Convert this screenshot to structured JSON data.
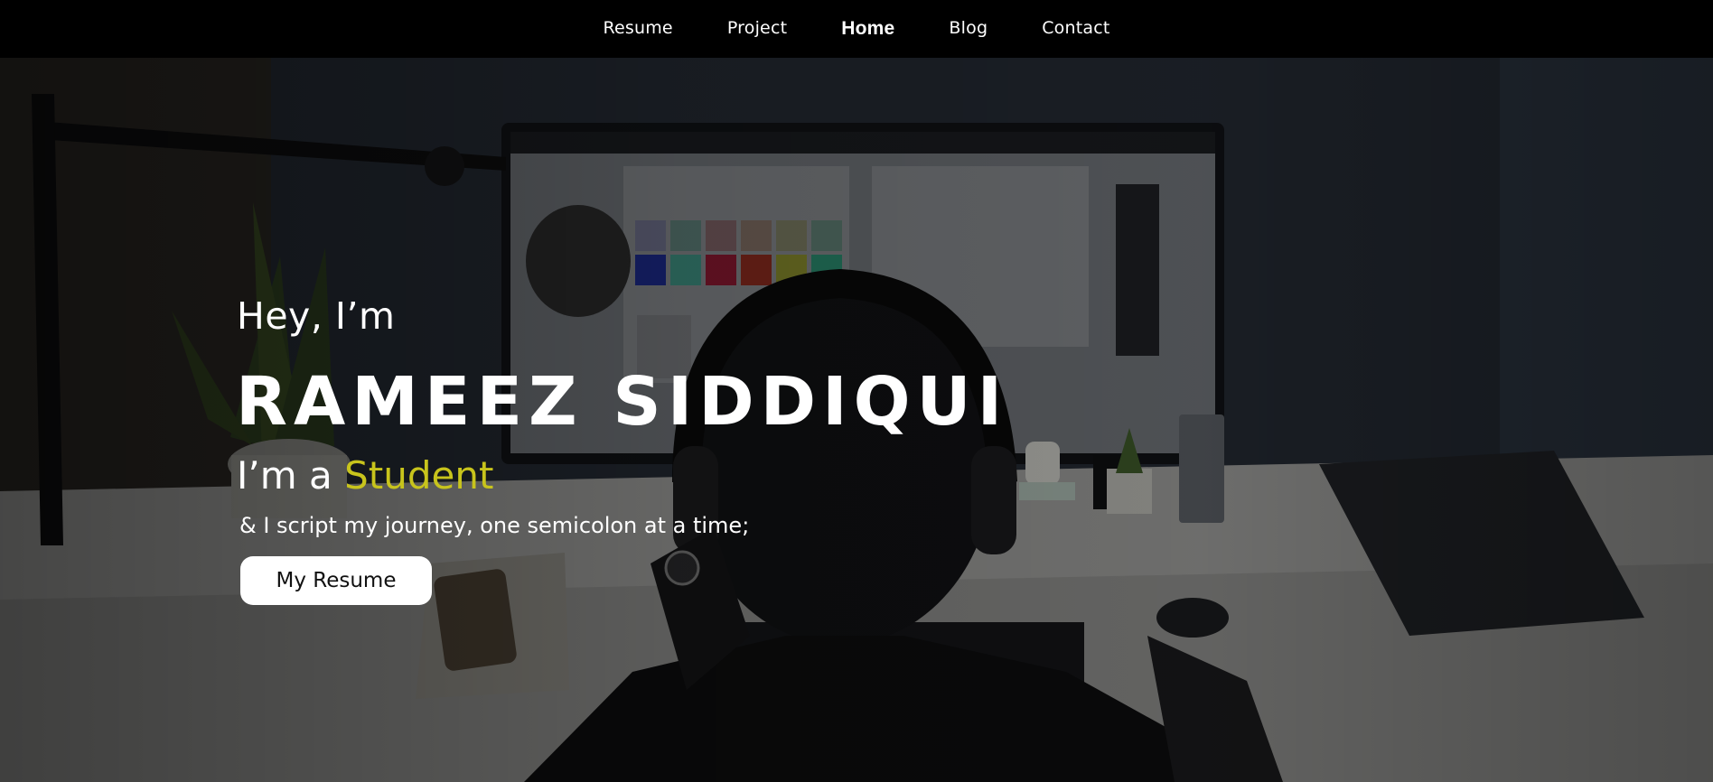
{
  "nav": {
    "items": [
      {
        "label": "Resume",
        "active": false
      },
      {
        "label": "Project",
        "active": false
      },
      {
        "label": "Home",
        "active": true
      },
      {
        "label": "Blog",
        "active": false
      },
      {
        "label": "Contact",
        "active": false
      }
    ]
  },
  "hero": {
    "greeting": "Hey, I’m",
    "name": "RAMEEZ SIDDIQUI",
    "role_prefix": "I’m a ",
    "role_highlight": "Student",
    "tagline": "& I script my journey, one semicolon at a time;",
    "cta_label": "My Resume",
    "background_image": "person-at-desk-photo",
    "highlight_color": "#c8c41c"
  }
}
